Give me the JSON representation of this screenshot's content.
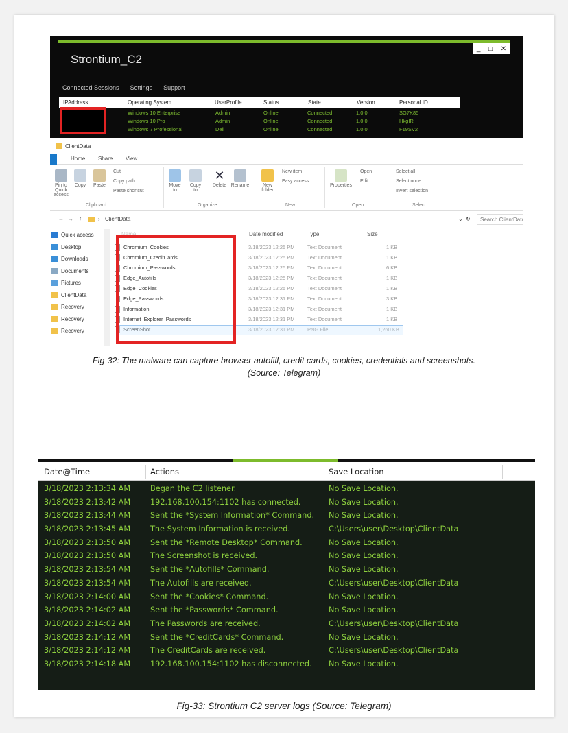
{
  "c2_window": {
    "title": "Strontium_C2",
    "window_buttons": [
      "_",
      "□",
      "✕"
    ],
    "menu": [
      "Connected Sessions",
      "Settings",
      "Support"
    ],
    "columns": [
      "IPAddress",
      "Operating System",
      "UserProfile",
      "Status",
      "State",
      "Version",
      "Personal ID"
    ],
    "rows": [
      [
        "",
        "Windows 10 Enterprise",
        "Admin",
        "Online",
        "Connected",
        "1.0.0",
        "SG7K85"
      ],
      [
        "",
        "Windows 10 Pro",
        "Admin",
        "Online",
        "Connected",
        "1.0.0",
        "HkgIR"
      ],
      [
        "",
        "Windows 7 Professional",
        "Dell",
        "Online",
        "Connected",
        "1.0.0",
        "F19SV2"
      ]
    ]
  },
  "explorer": {
    "title": "ClientData",
    "tabs": [
      "Home",
      "Share",
      "View"
    ],
    "ribbon": {
      "clipboard": [
        "Pin to Quick access",
        "Copy",
        "Paste",
        "Cut",
        "Copy path",
        "Paste shortcut"
      ],
      "organize": [
        "Move to",
        "Copy to",
        "Delete",
        "Rename"
      ],
      "new": [
        "New folder",
        "New item",
        "Easy access"
      ],
      "open": [
        "Properties",
        "Open",
        "Edit"
      ],
      "select": [
        "Select all",
        "Select none",
        "Invert selection"
      ],
      "groups": [
        "Clipboard",
        "Organize",
        "New",
        "Open",
        "Select"
      ]
    },
    "address": "ClientData",
    "search_placeholder": "Search ClientData",
    "nav": [
      "Quick access",
      "Desktop",
      "Downloads",
      "Documents",
      "Pictures",
      "ClientData",
      "Recovery",
      "Recovery",
      "Recovery"
    ],
    "columns": [
      "Name",
      "Date modified",
      "Type",
      "Size"
    ],
    "files": [
      [
        "Chromium_Cookies",
        "3/18/2023 12:25 PM",
        "Text Document",
        "1 KB"
      ],
      [
        "Chromium_CreditCards",
        "3/18/2023 12:25 PM",
        "Text Document",
        "1 KB"
      ],
      [
        "Chromium_Passwords",
        "3/18/2023 12:25 PM",
        "Text Document",
        "6 KB"
      ],
      [
        "Edge_Autofills",
        "3/18/2023 12:25 PM",
        "Text Document",
        "1 KB"
      ],
      [
        "Edge_Cookies",
        "3/18/2023 12:25 PM",
        "Text Document",
        "1 KB"
      ],
      [
        "Edge_Passwords",
        "3/18/2023 12:31 PM",
        "Text Document",
        "3 KB"
      ],
      [
        "Information",
        "3/18/2023 12:31 PM",
        "Text Document",
        "1 KB"
      ],
      [
        "Internet_Explorer_Passwords",
        "3/18/2023 12:31 PM",
        "Text Document",
        "1 KB"
      ],
      [
        "ScreenShot",
        "3/18/2023 12:31 PM",
        "PNG File",
        "1,260 KB"
      ]
    ]
  },
  "caption32": {
    "line1": "Fig-32: The malware can capture browser autofill, credit cards, cookies, credentials and screenshots.",
    "line2": "(Source: Telegram)"
  },
  "log": {
    "columns": [
      "Date@Time",
      "Actions",
      "Save Location"
    ],
    "rows": [
      [
        "3/18/2023 2:13:34 AM",
        "Began the C2 listener.",
        "No Save Location."
      ],
      [
        "3/18/2023 2:13:42 AM",
        "192.168.100.154:1102 has connected.",
        "No Save Location."
      ],
      [
        "3/18/2023 2:13:44 AM",
        "Sent the *System Information* Command.",
        "No Save Location."
      ],
      [
        "3/18/2023 2:13:45 AM",
        "The System Information is received.",
        "C:\\Users\\user\\Desktop\\ClientData"
      ],
      [
        "3/18/2023 2:13:50 AM",
        "Sent the *Remote Desktop* Command.",
        "No Save Location."
      ],
      [
        "3/18/2023 2:13:50 AM",
        "The Screenshot is received.",
        "No Save Location."
      ],
      [
        "3/18/2023 2:13:54 AM",
        "Sent the *Autofills* Command.",
        "No Save Location."
      ],
      [
        "3/18/2023 2:13:54 AM",
        "The Autofills are received.",
        "C:\\Users\\user\\Desktop\\ClientData"
      ],
      [
        "3/18/2023 2:14:00 AM",
        "Sent the *Cookies* Command.",
        "No Save Location."
      ],
      [
        "3/18/2023 2:14:02 AM",
        "Sent the *Passwords* Command.",
        "No Save Location."
      ],
      [
        "3/18/2023 2:14:02 AM",
        "The Passwords are received.",
        "C:\\Users\\user\\Desktop\\ClientData"
      ],
      [
        "3/18/2023 2:14:12 AM",
        "Sent the *CreditCards* Command.",
        "No Save Location."
      ],
      [
        "3/18/2023 2:14:12 AM",
        "The CreditCards are received.",
        "C:\\Users\\user\\Desktop\\ClientData"
      ],
      [
        "3/18/2023 2:14:18 AM",
        "192.168.100.154:1102 has disconnected.",
        "No Save Location."
      ]
    ]
  },
  "caption33": "Fig-33: Strontium C2 server logs (Source: Telegram)",
  "colors": {
    "accent_green": "#7dbb2c",
    "log_text": "#8dcf3e",
    "highlight_red": "#e32323",
    "log_background": "#151d16"
  }
}
